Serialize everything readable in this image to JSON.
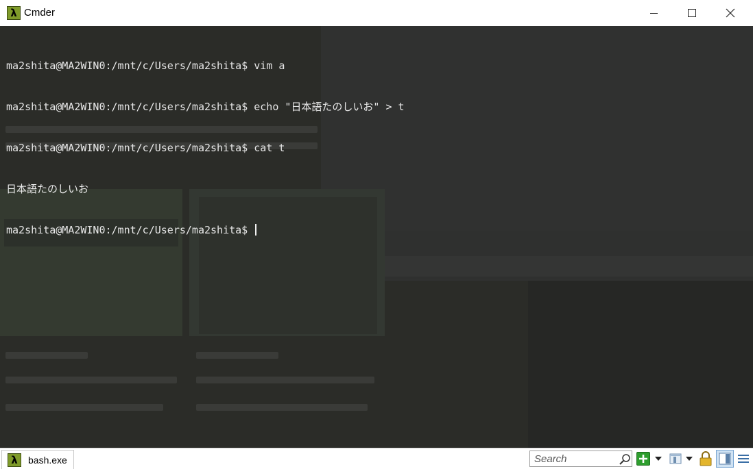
{
  "window": {
    "title": "Cmder",
    "app_icon_glyph": "λ",
    "controls": {
      "minimize": "minimize-icon",
      "maximize": "maximize-icon",
      "close": "close-icon"
    }
  },
  "terminal": {
    "lines": [
      "ma2shita@MA2WIN0:/mnt/c/Users/ma2shita$ vim a",
      "ma2shita@MA2WIN0:/mnt/c/Users/ma2shita$ echo \"日本語たのしいお\" > t",
      "ma2shita@MA2WIN0:/mnt/c/Users/ma2shita$ cat t",
      "日本語たのしいお"
    ],
    "prompt": "ma2shita@MA2WIN0:/mnt/c/Users/ma2shita$ ",
    "colors": {
      "background": "#2b2c28",
      "foreground": "#e8e8e8"
    }
  },
  "statusbar": {
    "tab_label": "bash.exe",
    "tab_icon_glyph": "λ",
    "search_placeholder": "Search",
    "icons": [
      "search-icon",
      "new-console-icon",
      "dropdown-icon",
      "panel-icon",
      "lock-icon",
      "split-view-icon",
      "menu-icon"
    ],
    "accent": "#7f9b2a"
  }
}
